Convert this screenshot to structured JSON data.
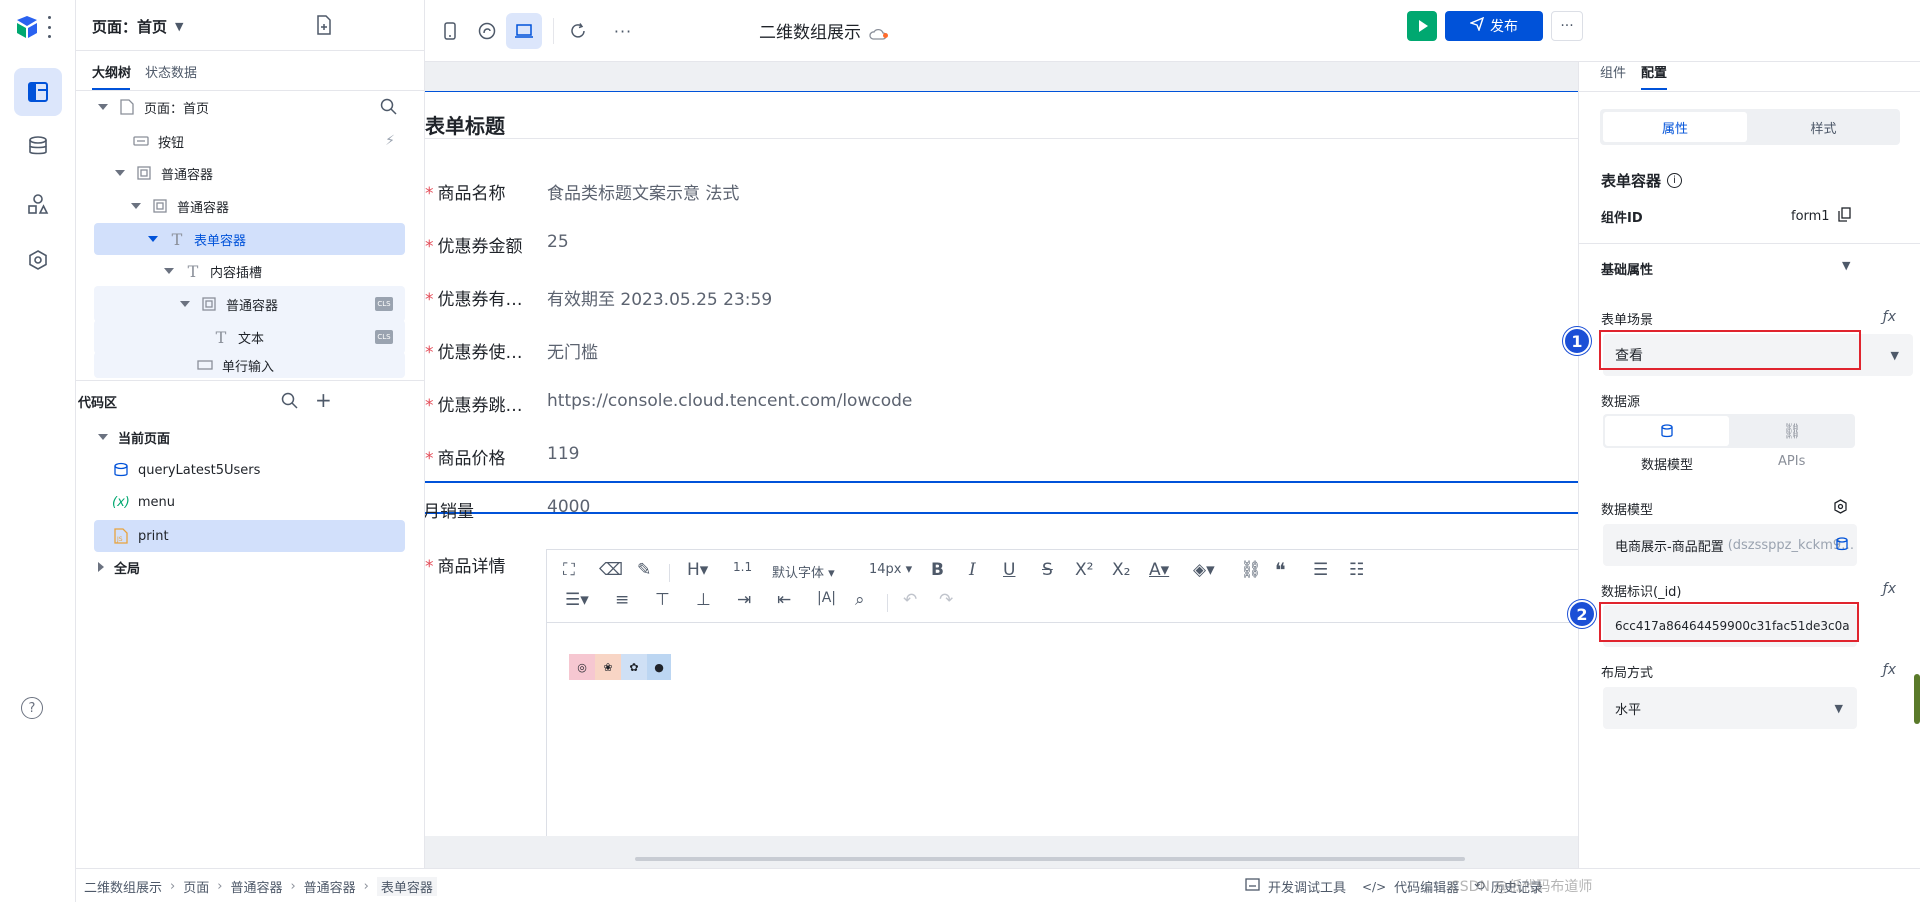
{
  "rail": {
    "items": [
      "outline",
      "data",
      "components",
      "settings"
    ],
    "help_icon": "question-icon"
  },
  "tree_panel": {
    "page_selector": "页面：首页",
    "tabs": [
      "大纲树",
      "状态数据"
    ],
    "nodes": [
      {
        "label": "页面：首页"
      },
      {
        "label": "按钮"
      },
      {
        "label": "普通容器"
      },
      {
        "label": "普通容器"
      },
      {
        "label": "表单容器"
      },
      {
        "label": "内容插槽"
      },
      {
        "label": "普通容器"
      },
      {
        "label": "文本"
      },
      {
        "label": "单行输入"
      }
    ],
    "cls_tag": "CLS"
  },
  "code_panel": {
    "title": "代码区",
    "current_page": "当前页面",
    "items": [
      "queryLatest5Users",
      "menu",
      "print"
    ],
    "global": "全局"
  },
  "topbar": {
    "app_title": "二维数组展示",
    "publish_label": "发布",
    "more": "···"
  },
  "form": {
    "title": "表单标题",
    "fields": [
      {
        "label": "商品名称",
        "value": "食品类标题文案示意 法式",
        "required": true
      },
      {
        "label": "优惠券金额",
        "value": "25",
        "required": true
      },
      {
        "label": "优惠券有…",
        "value": "有效期至 2023.05.25 23:59",
        "required": true
      },
      {
        "label": "优惠券使…",
        "value": "无门槛",
        "required": true
      },
      {
        "label": "优惠券跳…",
        "value": "https://console.cloud.tencent.com/lowcode",
        "required": true
      },
      {
        "label": "商品价格",
        "value": "119",
        "required": true
      },
      {
        "label": "月销量",
        "value": "4000",
        "required": false
      },
      {
        "label": "商品详情",
        "value": "",
        "required": true
      }
    ],
    "rte": {
      "font": "默认字体",
      "size": "14px"
    }
  },
  "right_panel": {
    "tabs": [
      "组件",
      "配置"
    ],
    "seg": [
      "属性",
      "样式"
    ],
    "component_title": "表单容器",
    "component_id_label": "组件ID",
    "component_id": "form1",
    "section": "基础属性",
    "scene_label": "表单场景",
    "scene_value": "查看",
    "datasource_label": "数据源",
    "datasource_tabs": [
      "数据模型",
      "APIs"
    ],
    "model_label": "数据模型",
    "model_value": "电商展示-商品配置",
    "model_hint": "(dszssppz_kckm9…",
    "id_label": "数据标识(_id)",
    "id_value": "6cc417a86464459900c31fac51de3c0a",
    "layout_label": "布局方式",
    "layout_value": "水平",
    "badges": [
      "1",
      "2"
    ]
  },
  "status": {
    "breadcrumb": [
      "二维数组展示",
      "页面",
      "普通容器",
      "普通容器",
      "表单容器"
    ],
    "debug": "开发调试工具",
    "code_editor": "代码编辑器",
    "history": "历史记录",
    "watermark": "CSDN @低代码布道师"
  },
  "colors": {
    "primary": "#0052d9",
    "run": "#00a870",
    "danger": "#e0242e"
  }
}
